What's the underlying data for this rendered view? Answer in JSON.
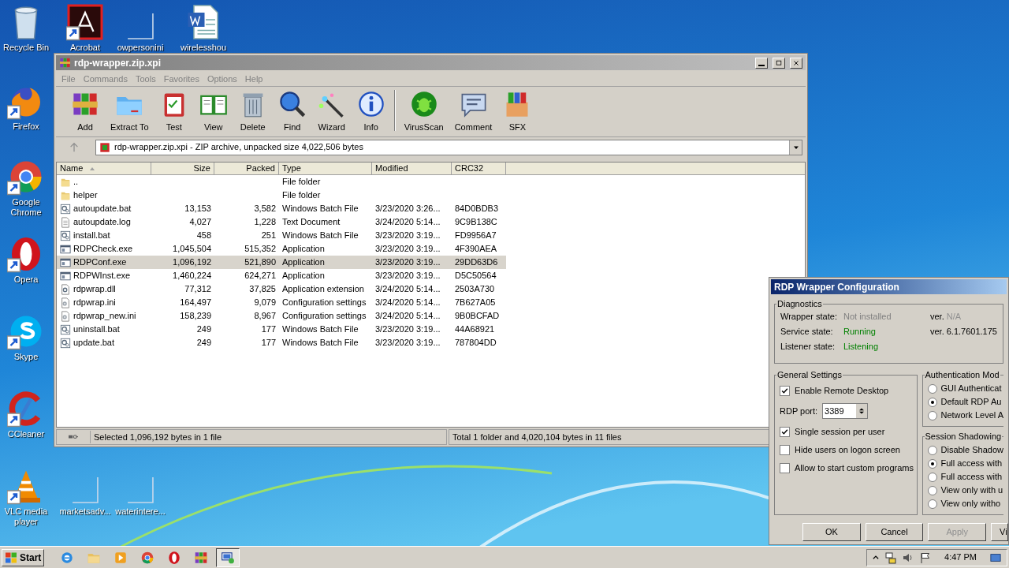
{
  "desktop_icons": [
    {
      "label": "Recycle Bin",
      "kind": "recycle"
    },
    {
      "label": "Acrobat",
      "kind": "acrobat"
    },
    {
      "label": "owpersonini",
      "kind": "blank"
    },
    {
      "label": "wirelesshou",
      "kind": "word"
    },
    {
      "label": "Firefox",
      "kind": "firefox"
    },
    {
      "label": "Google Chrome",
      "kind": "chrome"
    },
    {
      "label": "Opera",
      "kind": "opera"
    },
    {
      "label": "Skype",
      "kind": "skype"
    },
    {
      "label": "CCleaner",
      "kind": "ccleaner"
    },
    {
      "label": "VLC media player",
      "kind": "vlc"
    },
    {
      "label": "marketsadv...",
      "kind": "blank"
    },
    {
      "label": "waterintere...",
      "kind": "blank"
    }
  ],
  "archive_window": {
    "title": "rdp-wrapper.zip.xpi",
    "menu": [
      "File",
      "Commands",
      "Tools",
      "Favorites",
      "Options",
      "Help"
    ],
    "toolbar_groups": [
      [
        {
          "label": "Add",
          "kind": "add"
        },
        {
          "label": "Extract To",
          "kind": "extract"
        },
        {
          "label": "Test",
          "kind": "test"
        },
        {
          "label": "View",
          "kind": "view"
        },
        {
          "label": "Delete",
          "kind": "delete"
        },
        {
          "label": "Find",
          "kind": "find"
        },
        {
          "label": "Wizard",
          "kind": "wizard"
        },
        {
          "label": "Info",
          "kind": "info"
        }
      ],
      [
        {
          "label": "VirusScan",
          "kind": "virus"
        },
        {
          "label": "Comment",
          "kind": "comment"
        },
        {
          "label": "SFX",
          "kind": "sfx"
        }
      ]
    ],
    "address": "rdp-wrapper.zip.xpi - ZIP archive, unpacked size 4,022,506 bytes",
    "columns": [
      {
        "label": "Name",
        "sorted": true
      },
      {
        "label": "Size",
        "sorted": false
      },
      {
        "label": "Packed",
        "sorted": false
      },
      {
        "label": "Type",
        "sorted": false
      },
      {
        "label": "Modified",
        "sorted": false
      },
      {
        "label": "CRC32",
        "sorted": false
      }
    ],
    "rows": [
      {
        "kind": "folder",
        "name": "..",
        "size": "",
        "packed": "",
        "type": "File folder",
        "modified": "",
        "crc": "",
        "selected": false
      },
      {
        "kind": "folder",
        "name": "helper",
        "size": "",
        "packed": "",
        "type": "File folder",
        "modified": "",
        "crc": "",
        "selected": false
      },
      {
        "kind": "batch",
        "name": "autoupdate.bat",
        "size": "13,153",
        "packed": "3,582",
        "type": "Windows Batch File",
        "modified": "3/23/2020 3:26...",
        "crc": "84D0BDB3",
        "selected": false
      },
      {
        "kind": "text",
        "name": "autoupdate.log",
        "size": "4,027",
        "packed": "1,228",
        "type": "Text Document",
        "modified": "3/24/2020 5:14...",
        "crc": "9C9B138C",
        "selected": false
      },
      {
        "kind": "batch",
        "name": "install.bat",
        "size": "458",
        "packed": "251",
        "type": "Windows Batch File",
        "modified": "3/23/2020 3:19...",
        "crc": "FD9956A7",
        "selected": false
      },
      {
        "kind": "exe",
        "name": "RDPCheck.exe",
        "size": "1,045,504",
        "packed": "515,352",
        "type": "Application",
        "modified": "3/23/2020 3:19...",
        "crc": "4F390AEA",
        "selected": false
      },
      {
        "kind": "exe",
        "name": "RDPConf.exe",
        "size": "1,096,192",
        "packed": "521,890",
        "type": "Application",
        "modified": "3/23/2020 3:19...",
        "crc": "29DD63D6",
        "selected": true
      },
      {
        "kind": "exe",
        "name": "RDPWInst.exe",
        "size": "1,460,224",
        "packed": "624,271",
        "type": "Application",
        "modified": "3/23/2020 3:19...",
        "crc": "D5C50564",
        "selected": false
      },
      {
        "kind": "dll",
        "name": "rdpwrap.dll",
        "size": "77,312",
        "packed": "37,825",
        "type": "Application extension",
        "modified": "3/24/2020 5:14...",
        "crc": "2503A730",
        "selected": false
      },
      {
        "kind": "ini",
        "name": "rdpwrap.ini",
        "size": "164,497",
        "packed": "9,079",
        "type": "Configuration settings",
        "modified": "3/24/2020 5:14...",
        "crc": "7B627A05",
        "selected": false
      },
      {
        "kind": "ini",
        "name": "rdpwrap_new.ini",
        "size": "158,239",
        "packed": "8,967",
        "type": "Configuration settings",
        "modified": "3/24/2020 5:14...",
        "crc": "9B0BCFAD",
        "selected": false
      },
      {
        "kind": "batch",
        "name": "uninstall.bat",
        "size": "249",
        "packed": "177",
        "type": "Windows Batch File",
        "modified": "3/23/2020 3:19...",
        "crc": "44A68921",
        "selected": false
      },
      {
        "kind": "batch",
        "name": "update.bat",
        "size": "249",
        "packed": "177",
        "type": "Windows Batch File",
        "modified": "3/23/2020 3:19...",
        "crc": "787804DD",
        "selected": false
      }
    ],
    "status_left": "Selected 1,096,192 bytes in 1 file",
    "status_right": "Total 1 folder and 4,020,104 bytes in 11 files"
  },
  "rdp_dialog": {
    "title": "RDP Wrapper Configuration",
    "diagnostics": {
      "label": "Diagnostics",
      "rows": [
        {
          "label": "Wrapper state:",
          "value": "Not installed",
          "color": "#808080",
          "version_label": "ver.",
          "version": "N/A",
          "version_disabled": true
        },
        {
          "label": "Service state:",
          "value": "Running",
          "color": "#008000",
          "version_label": "ver.",
          "version": "6.1.7601.175",
          "version_disabled": false
        },
        {
          "label": "Listener state:",
          "value": "Listening",
          "color": "#008000"
        }
      ]
    },
    "general": {
      "label": "General Settings",
      "items": [
        {
          "kind": "checkbox",
          "label": "Enable Remote Desktop",
          "checked": true
        },
        {
          "kind": "port",
          "label": "RDP port:",
          "value": "3389"
        },
        {
          "kind": "checkbox",
          "label": "Single session per user",
          "checked": true
        },
        {
          "kind": "checkbox",
          "label": "Hide users on logon screen",
          "checked": false
        },
        {
          "kind": "checkbox",
          "label": "Allow to start custom programs",
          "checked": false
        }
      ]
    },
    "auth": {
      "label": "Authentication Mod",
      "options": [
        {
          "label": "GUI Authenticat",
          "selected": false
        },
        {
          "label": "Default RDP Au",
          "selected": true
        },
        {
          "label": "Network Level A",
          "selected": false
        }
      ]
    },
    "shadow": {
      "label": "Session Shadowing",
      "options": [
        {
          "label": "Disable Shadow",
          "selected": false
        },
        {
          "label": "Full access with",
          "selected": true
        },
        {
          "label": "Full access with",
          "selected": false
        },
        {
          "label": "View only with u",
          "selected": false
        },
        {
          "label": "View only witho",
          "selected": false
        }
      ]
    },
    "buttons": [
      {
        "label": "OK",
        "disabled": false
      },
      {
        "label": "Cancel",
        "disabled": false
      },
      {
        "label": "Apply",
        "disabled": true
      },
      {
        "label": "Vi",
        "disabled": false
      }
    ]
  },
  "taskbar": {
    "start": "Start",
    "items": [
      {
        "kind": "ie",
        "selected": false
      },
      {
        "kind": "explorer",
        "selected": false
      },
      {
        "kind": "media",
        "selected": false
      },
      {
        "kind": "chrome",
        "selected": false
      },
      {
        "kind": "opera",
        "selected": false
      },
      {
        "kind": "winrar",
        "selected": false
      },
      {
        "kind": "rdp",
        "selected": true
      }
    ],
    "clock": "4:47 PM"
  }
}
